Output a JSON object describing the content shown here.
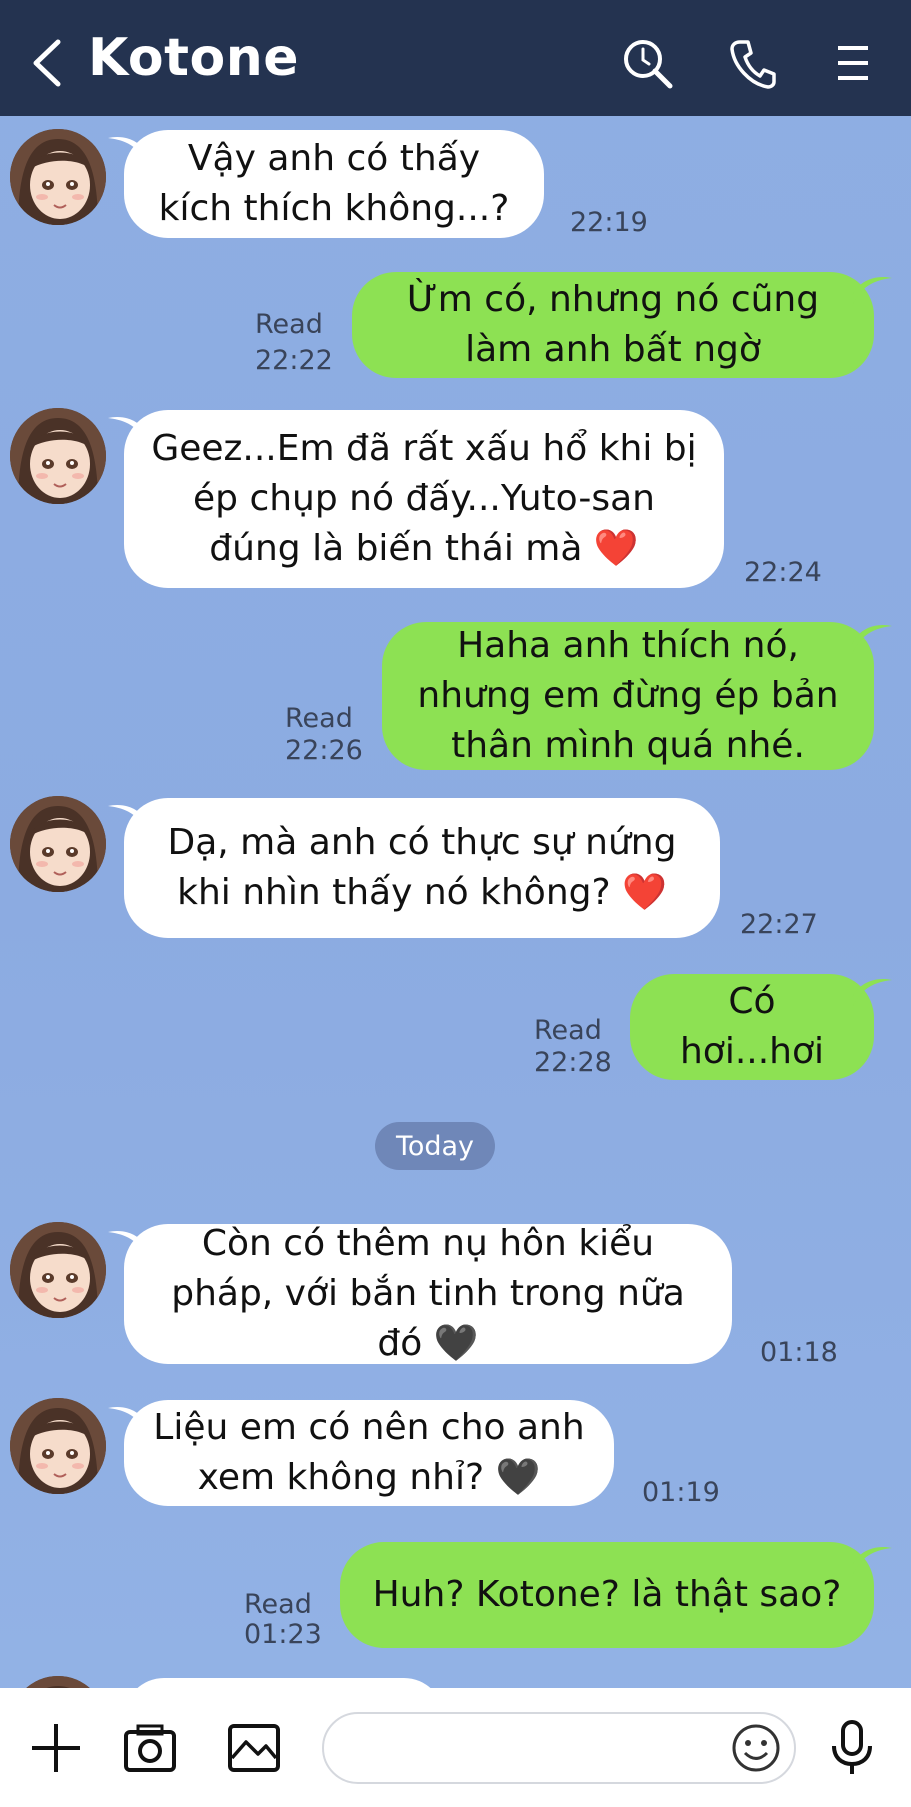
{
  "header": {
    "contact_name": "Kotone",
    "icons": [
      "back-arrow-icon",
      "search-icon",
      "phone-icon",
      "menu-icon"
    ],
    "background": "#243350"
  },
  "colors": {
    "incoming_bubble": "#ffffff",
    "outgoing_bubble": "#8de153",
    "chat_background": "#8eaee3"
  },
  "messages": [
    {
      "dir": "in",
      "text": "Vậy anh có thấy kích thích không...?",
      "time": "22:19"
    },
    {
      "dir": "out",
      "text": "Ừm có, nhưng nó cũng làm anh bất ngờ",
      "read": "Read",
      "time": "22:22"
    },
    {
      "dir": "in",
      "text": "Geez...Em đã rất xấu hổ khi bị ép chụp nó đấy...Yuto-san đúng là biến thái mà ❤️",
      "time": "22:24"
    },
    {
      "dir": "out",
      "text": "Haha anh thích nó, nhưng em đừng ép bản thân mình quá nhé.",
      "read": "Read",
      "time": "22:26"
    },
    {
      "dir": "in",
      "text": "Dạ, mà anh có thực sự nứng khi nhìn thấy nó không? ❤️",
      "time": "22:27"
    },
    {
      "dir": "out",
      "text": "Có hơi...hơi",
      "read": "Read",
      "time": "22:28"
    },
    {
      "dir": "in",
      "text": "Còn có thêm nụ hôn kiểu pháp, với bắn tinh trong nữa đó 🖤",
      "time": "01:18"
    },
    {
      "dir": "in",
      "text": "Liệu em có nên cho anh xem không nhỉ? 🖤",
      "time": "01:19"
    },
    {
      "dir": "out",
      "text": "Huh? Kotone? là thật sao?",
      "read": "Read",
      "time": "01:23"
    }
  ],
  "date_divider": "Today",
  "input_bar": {
    "icons": [
      "plus-icon",
      "camera-icon",
      "image-icon",
      "emoji-icon",
      "microphone-icon"
    ],
    "placeholder": ""
  }
}
